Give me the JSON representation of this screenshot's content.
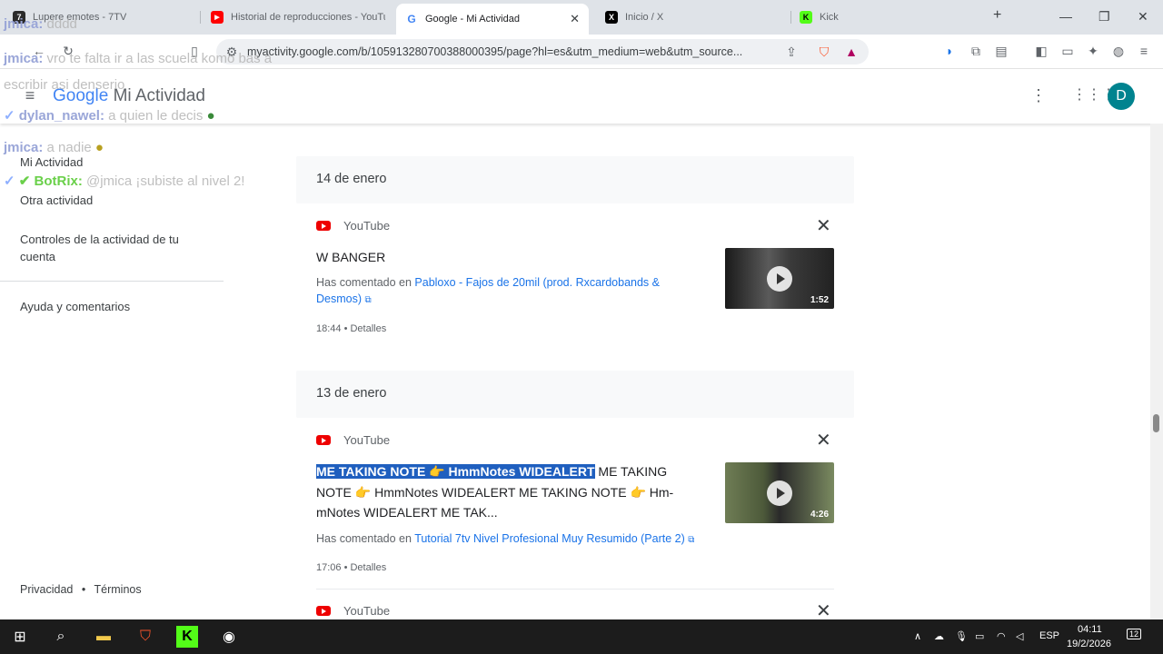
{
  "tabs": [
    {
      "title": "Lupere emotes - 7TV",
      "favicon": "7tv-icon",
      "fav_color": "#2b2b2b",
      "fav_text": "7"
    },
    {
      "title": "Historial de reproducciones - YouTube",
      "favicon": "youtube-icon",
      "fav_color": "#ff0000",
      "fav_text": "▶"
    },
    {
      "title": "Google - Mi Actividad",
      "favicon": "google-icon",
      "fav_color": "#4285f4",
      "fav_text": "G"
    },
    {
      "title": "Inicio / X",
      "favicon": "x-icon",
      "fav_color": "#000000",
      "fav_text": "X"
    },
    {
      "title": "Kick",
      "favicon": "kick-icon",
      "fav_color": "#53fc18",
      "fav_text": "K"
    }
  ],
  "new_tab": "+",
  "window_controls": {
    "minimize": "—",
    "restore": "❐",
    "close": "✕"
  },
  "url": "myactivity.google.com/b/105913280700388000395/page?hl=es&utm_medium=web&utm_source...",
  "chat": [
    {
      "user": "jmica:",
      "msg": "dddd"
    },
    {
      "user": "jmica:",
      "msg": "vro te falta ir a las scuela komo bas a"
    },
    {
      "user": "",
      "msg": "escribir asi denserio"
    },
    {
      "user": "dylan_nawel:",
      "msg": "a quien le decis"
    },
    {
      "user": "jmica:",
      "msg": "a nadie"
    },
    {
      "user": "BotRix:",
      "msg": "@jmica ¡subiste al nivel 2!"
    }
  ],
  "header": {
    "logo": "Google",
    "title": "Mi Actividad",
    "avatar_letter": "D"
  },
  "sidebar": {
    "items": [
      "Mi Actividad",
      "Otra actividad",
      "Controles de la actividad de tu cuenta",
      "Ayuda y comentarios"
    ],
    "footer_privacy": "Privacidad",
    "footer_dot": "•",
    "footer_terms": "Términos"
  },
  "feed": {
    "day1": "14 de enero",
    "day2": "13 de enero",
    "source": "YouTube",
    "entry1": {
      "title": "W BANGER",
      "prefix": "Has comentado en ",
      "link": "Pabloxo - Fajos de 20mil (prod. Rxcardobands & Desmos)",
      "meta": "18:44 • Detalles",
      "duration": "1:52"
    },
    "entry2": {
      "highlight": "ME TAKING NOTE 👉 HmmNotes WIDEALERT",
      "rest1": " ME TAKING",
      "line2": "NOTE 👉 HmmNotes WIDEALERT ME TAKING NOTE 👉 Hm-",
      "line3": "mNotes WIDEALERT ME TAK...",
      "prefix": "Has comentado en ",
      "link": "Tutorial 7tv Nivel Profesional Muy Resumido (Parte 2)",
      "meta": "17:06 • Detalles",
      "duration": "4:26"
    },
    "entry3_source": "YouTube"
  },
  "taskbar": {
    "lang": "ESP",
    "time": "04:11",
    "date": "19/2/2026",
    "notif_count": "12"
  }
}
